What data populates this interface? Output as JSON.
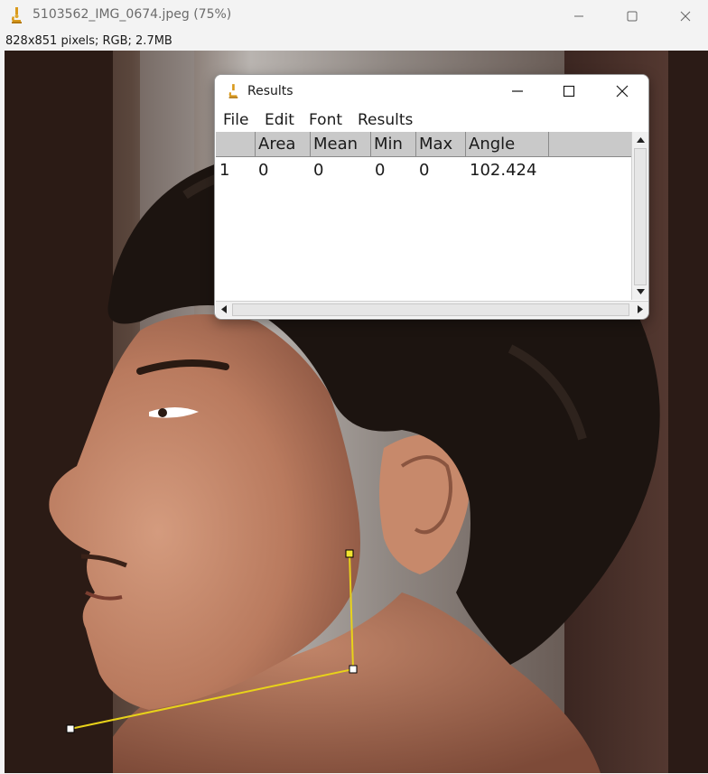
{
  "window": {
    "title": "5103562_IMG_0674.jpeg (75%)",
    "info": "828x851 pixels; RGB; 2.7MB"
  },
  "icons": {
    "app": "microscope-icon",
    "minimize": "minimize-icon",
    "maximize": "maximize-icon",
    "close": "close-icon"
  },
  "results_window": {
    "title": "Results",
    "menu": [
      "File",
      "Edit",
      "Font",
      "Results"
    ],
    "columns": [
      "",
      "Area",
      "Mean",
      "Min",
      "Max",
      "Angle"
    ],
    "rows": [
      [
        "1",
        "0",
        "0",
        "0",
        "0",
        "102.424"
      ]
    ]
  },
  "overlay": {
    "tool": "angle",
    "color": "#e8d21a",
    "measured_angle": "102.424"
  },
  "colors": {
    "titlebar": "#f3f3f3",
    "table_header": "#c9c9c9",
    "handle_active": "#f2e430"
  }
}
